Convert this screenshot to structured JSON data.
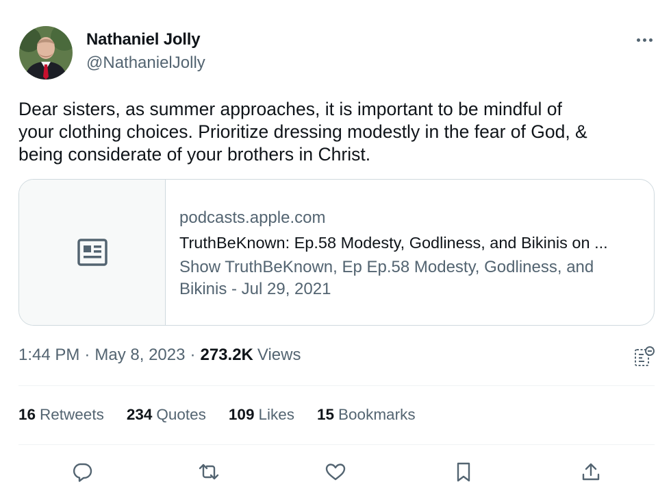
{
  "author": {
    "display_name": "Nathaniel Jolly",
    "handle": "@NathanielJolly"
  },
  "tweet": {
    "text": "Dear sisters, as summer approaches, it is important to be mindful of\nyour clothing choices. Prioritize dressing modestly in the fear of God, &\nbeing considerate of your brothers in Christ."
  },
  "card": {
    "domain": "podcasts.apple.com",
    "title": "TruthBeKnown: Ep.58 Modesty, Godliness, and Bikinis on ...",
    "description": "Show TruthBeKnown, Ep Ep.58 Modesty, Godliness, and Bikinis - Jul 29, 2021",
    "thumbnail_icon": "news-article-icon"
  },
  "meta": {
    "time": "1:44 PM",
    "separator": "·",
    "date": "May 8, 2023",
    "views_count": "273.2K",
    "views_label": "Views"
  },
  "stats": {
    "retweets": {
      "count": "16",
      "label": "Retweets"
    },
    "quotes": {
      "count": "234",
      "label": "Quotes"
    },
    "likes": {
      "count": "109",
      "label": "Likes"
    },
    "bookmarks": {
      "count": "15",
      "label": "Bookmarks"
    }
  },
  "actions": [
    "reply-icon",
    "retweet-icon",
    "like-icon",
    "bookmark-icon",
    "share-icon"
  ],
  "colors": {
    "text_primary": "#0f1419",
    "text_secondary": "#536471",
    "border": "#cfd9de",
    "divider": "#eff3f4",
    "tie": "#c8102e"
  }
}
